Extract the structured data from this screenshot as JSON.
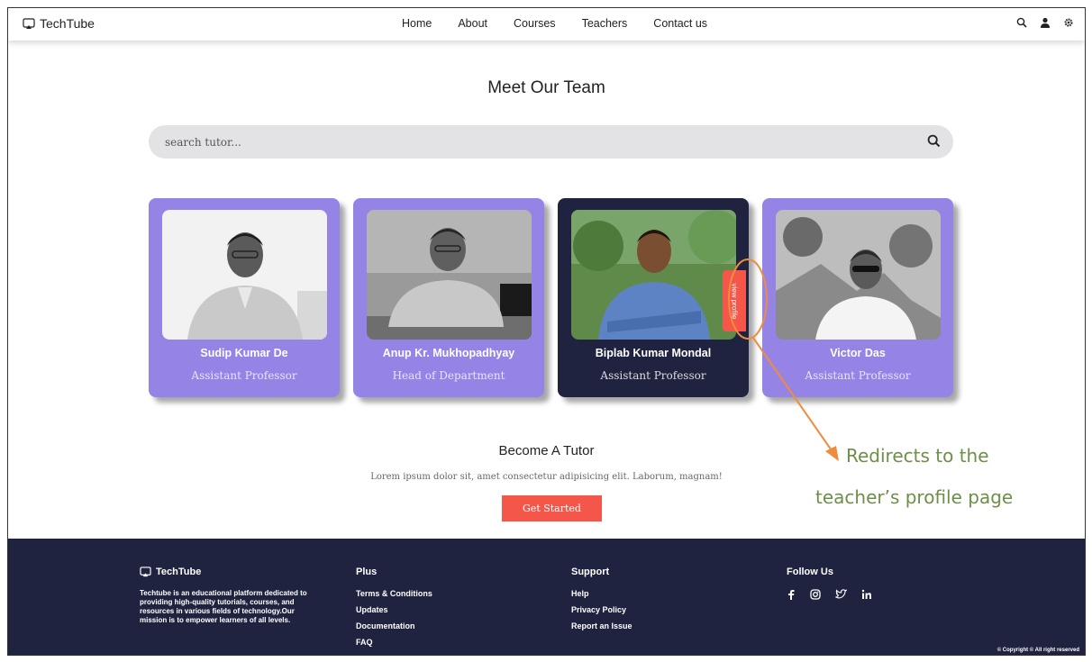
{
  "header": {
    "logo_text": "TechTube",
    "nav": [
      "Home",
      "About",
      "Courses",
      "Teachers",
      "Contact us"
    ]
  },
  "main": {
    "title": "Meet Our Team",
    "search": {
      "placeholder": "search tutor..."
    },
    "teachers": [
      {
        "name": "Sudip Kumar De",
        "role": "Assistant Professor"
      },
      {
        "name": "Anup Kr. Mukhopadhyay",
        "role": "Head of Department"
      },
      {
        "name": "Biplab Kumar Mondal",
        "role": "Assistant Professor",
        "view_profile": "view profile"
      },
      {
        "name": "Victor Das",
        "role": "Assistant Professor"
      }
    ],
    "become": {
      "title": "Become A Tutor",
      "text": "Lorem ipsum dolor sit, amet consectetur adipisicing elit. Laborum, magnam!",
      "button": "Get Started"
    }
  },
  "annotation": {
    "line1": "Redirects to the",
    "line2": "teacher’s profile page"
  },
  "footer": {
    "brand": "TechTube",
    "description": "Techtube is an educational platform dedicated to providing high-quality tutorials, courses, and resources in various fields of technology.Our mission is to empower learners of all levels.",
    "plus": {
      "title": "Plus",
      "links": [
        "Terms & Conditions",
        "Updates",
        "Documentation",
        "FAQ"
      ]
    },
    "support": {
      "title": "Support",
      "links": [
        "Help",
        "Privacy Policy",
        "Report an Issue"
      ]
    },
    "follow": {
      "title": "Follow Us",
      "icons": [
        "facebook-icon",
        "instagram-icon",
        "twitter-icon",
        "linkedin-icon"
      ]
    },
    "copyright": "© Copyright © All right reserved"
  },
  "colors": {
    "accent": "#f4574a",
    "card": "#9583e6",
    "dark": "#1f2340",
    "annotation": "#6d8f47"
  }
}
